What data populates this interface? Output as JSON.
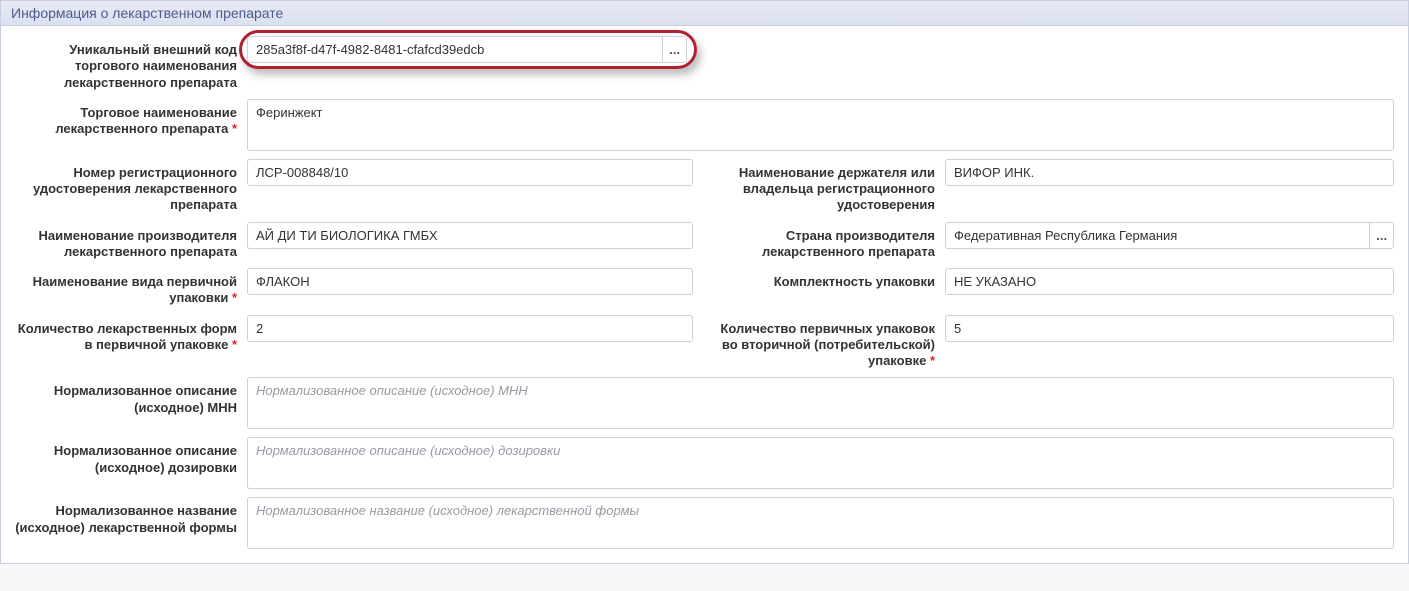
{
  "panel": {
    "title": "Информация о лекарственном препарате"
  },
  "labels": {
    "unique_code": "Уникальный внешний код торгового наименования лекарственного препарата",
    "trade_name": "Торговое наименование лекарственного препарата",
    "reg_number": "Номер регистрационного удостоверения лекарственного препарата",
    "holder_name": "Наименование держателя или владельца регистрационного удостоверения",
    "manufacturer": "Наименование производителя лекарственного препарата",
    "country": "Страна производителя лекарственного препарата",
    "primary_pack_type": "Наименование вида первичной упаковки",
    "pack_completeness": "Комплектность упаковки",
    "forms_in_primary": "Количество лекарственных форм в первичной упаковке",
    "primary_in_secondary": "Количество первичных упаковок во вторичной (потребительской) упаковке",
    "norm_mnn": "Нормализованное описание (исходное) МНН",
    "norm_dosage": "Нормализованное описание (исходное) дозировки",
    "norm_form": "Нормализованное название (исходное) лекарственной формы"
  },
  "values": {
    "unique_code": "285a3f8f-d47f-4982-8481-cfafcd39edcb",
    "trade_name": "Феринжект",
    "reg_number": "ЛСР-008848/10",
    "holder_name": "ВИФОР ИНК.",
    "manufacturer": "АЙ ДИ ТИ БИОЛОГИКА ГМБХ",
    "country": "Федеративная Республика Германия",
    "primary_pack_type": "ФЛАКОН",
    "pack_completeness": "НЕ УКАЗАНО",
    "forms_in_primary": "2",
    "primary_in_secondary": "5",
    "norm_mnn": "",
    "norm_dosage": "",
    "norm_form": ""
  },
  "placeholders": {
    "norm_mnn": "Нормализованное описание (исходное) МНН",
    "norm_dosage": "Нормализованное описание (исходное) дозировки",
    "norm_form": "Нормализованное название (исходное) лекарственной формы"
  },
  "buttons": {
    "lookup": "..."
  }
}
